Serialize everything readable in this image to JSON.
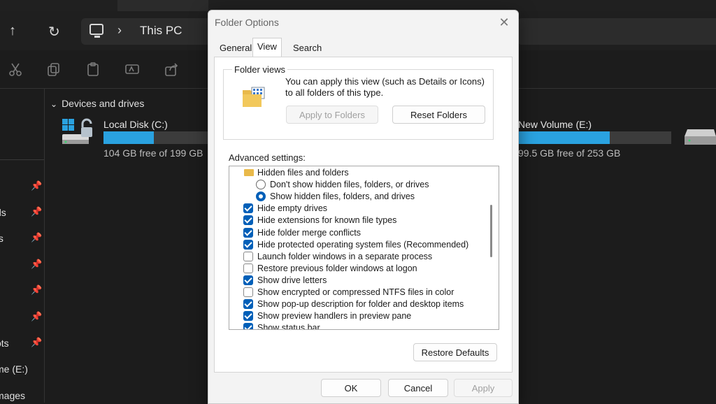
{
  "explorer": {
    "address_crumb": "This PC",
    "section_title": "Devices and drives",
    "sidebar_items": [
      "ds",
      "ts",
      "ots",
      "me (E:)",
      "mages"
    ],
    "drives": [
      {
        "name": "Local Disk (C:)",
        "free_text": "104 GB free of 199 GB",
        "used_fraction": 0.48
      },
      {
        "name": "New Volume (E:)",
        "free_text": "99.5 GB free of 253 GB",
        "used_fraction": 0.6
      }
    ]
  },
  "dialog": {
    "title": "Folder Options",
    "tabs": [
      "General",
      "View",
      "Search"
    ],
    "active_tab": "View",
    "folder_views": {
      "legend": "Folder views",
      "description": "You can apply this view (such as Details or Icons) to all folders of this type.",
      "apply_button": "Apply to Folders",
      "reset_button": "Reset Folders"
    },
    "advanced": {
      "label": "Advanced settings:",
      "items": [
        {
          "type": "folder",
          "text": "Hidden files and folders"
        },
        {
          "type": "radio",
          "checked": false,
          "text": "Don't show hidden files, folders, or drives"
        },
        {
          "type": "radio",
          "checked": true,
          "text": "Show hidden files, folders, and drives"
        },
        {
          "type": "check",
          "checked": true,
          "text": "Hide empty drives"
        },
        {
          "type": "check",
          "checked": true,
          "text": "Hide extensions for known file types"
        },
        {
          "type": "check",
          "checked": true,
          "text": "Hide folder merge conflicts"
        },
        {
          "type": "check",
          "checked": true,
          "text": "Hide protected operating system files (Recommended)"
        },
        {
          "type": "check",
          "checked": false,
          "text": "Launch folder windows in a separate process"
        },
        {
          "type": "check",
          "checked": false,
          "text": "Restore previous folder windows at logon"
        },
        {
          "type": "check",
          "checked": true,
          "text": "Show drive letters"
        },
        {
          "type": "check",
          "checked": false,
          "text": "Show encrypted or compressed NTFS files in color"
        },
        {
          "type": "check",
          "checked": true,
          "text": "Show pop-up description for folder and desktop items"
        },
        {
          "type": "check",
          "checked": true,
          "text": "Show preview handlers in preview pane"
        },
        {
          "type": "check",
          "checked": true,
          "text": "Show status bar"
        }
      ]
    },
    "restore_defaults": "Restore Defaults",
    "ok": "OK",
    "cancel": "Cancel",
    "apply": "Apply"
  }
}
